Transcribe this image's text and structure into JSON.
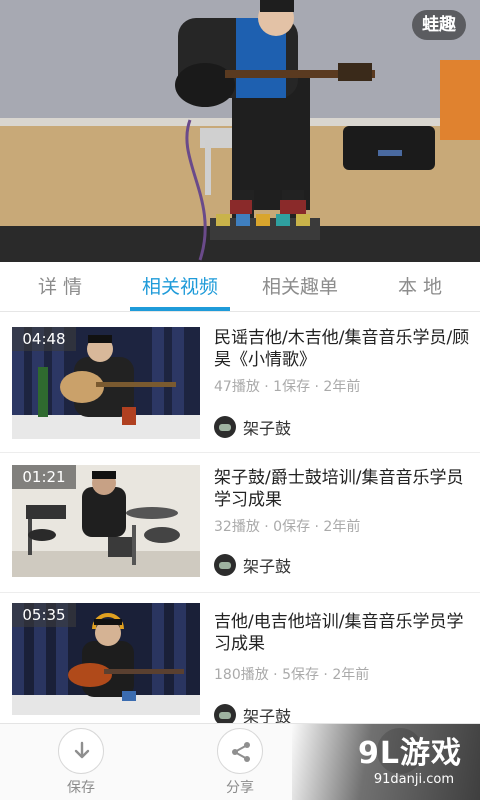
{
  "player": {
    "brand_badge": "蛙趣"
  },
  "tabs": [
    {
      "label": "详 情",
      "active": false
    },
    {
      "label": "相关视频",
      "active": true
    },
    {
      "label": "相关趣单",
      "active": false
    },
    {
      "label": "本 地",
      "active": false
    }
  ],
  "videos": [
    {
      "duration": "04:48",
      "title": "民谣吉他/木吉他/集音音乐学员/顾昊《小情歌》",
      "meta": "47播放 · 1保存 · 2年前",
      "uploader": "架子鼓"
    },
    {
      "duration": "01:21",
      "title": "架子鼓/爵士鼓培训/集音音乐学员学习成果",
      "meta": "32播放 · 0保存 · 2年前",
      "uploader": "架子鼓"
    },
    {
      "duration": "05:35",
      "title": "吉他/电吉他培训/集音音乐学员学习成果",
      "meta": "180播放 · 5保存 · 2年前",
      "uploader": "架子鼓"
    }
  ],
  "bottom_actions": [
    {
      "label": "保存",
      "icon": "download-icon"
    },
    {
      "label": "分享",
      "icon": "share-icon"
    },
    {
      "label": "",
      "icon": "more-icon"
    }
  ],
  "watermark": {
    "logo": "9L游戏",
    "url": "91danji.com"
  },
  "colors": {
    "accent": "#1f9bd9",
    "tab_inactive": "#8c8c8c",
    "meta_text": "#aaaaaa"
  }
}
